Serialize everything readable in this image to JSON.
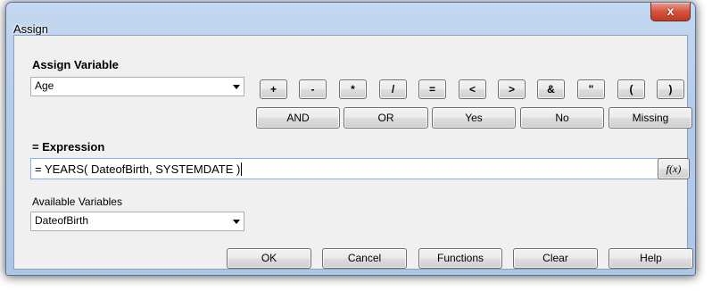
{
  "window": {
    "title": "Assign",
    "close_label": "x"
  },
  "assign_variable": {
    "label": "Assign Variable",
    "selected": "Age"
  },
  "operators": [
    "+",
    "-",
    "*",
    "/",
    "=",
    "<",
    ">",
    "&",
    "\"",
    "(",
    ")"
  ],
  "word_buttons": [
    "AND",
    "OR",
    "Yes",
    "No",
    "Missing"
  ],
  "expression": {
    "label": "= Expression",
    "value": "= YEARS( DateofBirth, SYSTEMDATE )",
    "fx_label": "f(x)"
  },
  "available_variables": {
    "label": "Available Variables",
    "selected": "DateofBirth"
  },
  "dialog_buttons": {
    "ok": "OK",
    "cancel": "Cancel",
    "functions": "Functions",
    "clear": "Clear",
    "help": "Help"
  }
}
